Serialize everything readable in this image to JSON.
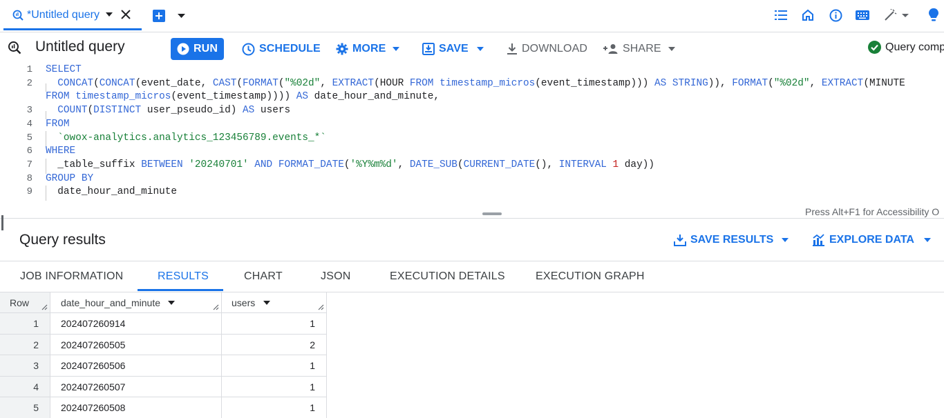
{
  "tabbar": {
    "tab_title": "*Untitled query",
    "icons": [
      "query-icon",
      "caret-down-icon",
      "close-icon",
      "add-tab-icon",
      "tab-menu-icon",
      "list-icon",
      "home-icon",
      "info-icon",
      "keyboard-icon",
      "magic-wand-icon",
      "lightbulb-icon"
    ]
  },
  "toolbar": {
    "title": "Untitled query",
    "run": "RUN",
    "schedule": "SCHEDULE",
    "more": "MORE",
    "save": "SAVE",
    "download": "DOWNLOAD",
    "share": "SHARE",
    "status": "Query comp",
    "status_color": "#188038"
  },
  "editor": {
    "line_numbers": [
      "1",
      "2",
      "",
      "3",
      "4",
      "5",
      "6",
      "7",
      "8",
      "9"
    ],
    "lines": [
      [
        {
          "t": "SELECT",
          "c": "kw"
        }
      ],
      [
        {
          "t": "  "
        },
        {
          "t": "CONCAT",
          "c": "fn"
        },
        {
          "t": "("
        },
        {
          "t": "CONCAT",
          "c": "fn"
        },
        {
          "t": "(event_date, "
        },
        {
          "t": "CAST",
          "c": "fn"
        },
        {
          "t": "("
        },
        {
          "t": "FORMAT",
          "c": "fn"
        },
        {
          "t": "("
        },
        {
          "t": "\"%02d\"",
          "c": "str"
        },
        {
          "t": ", "
        },
        {
          "t": "EXTRACT",
          "c": "fn"
        },
        {
          "t": "(HOUR "
        },
        {
          "t": "FROM",
          "c": "kw"
        },
        {
          "t": " "
        },
        {
          "t": "timestamp_micros",
          "c": "fn"
        },
        {
          "t": "(event_timestamp))) "
        },
        {
          "t": "AS",
          "c": "kw"
        },
        {
          "t": " "
        },
        {
          "t": "STRING",
          "c": "kw"
        },
        {
          "t": ")), "
        },
        {
          "t": "FORMAT",
          "c": "fn"
        },
        {
          "t": "("
        },
        {
          "t": "\"%02d\"",
          "c": "str"
        },
        {
          "t": ", "
        },
        {
          "t": "EXTRACT",
          "c": "fn"
        },
        {
          "t": "(MINUTE"
        }
      ],
      [
        {
          "t": "FROM",
          "c": "kw"
        },
        {
          "t": " "
        },
        {
          "t": "timestamp_micros",
          "c": "fn"
        },
        {
          "t": "(event_timestamp)))) "
        },
        {
          "t": "AS",
          "c": "kw"
        },
        {
          "t": " date_hour_and_minute,"
        }
      ],
      [
        {
          "t": "  "
        },
        {
          "t": "COUNT",
          "c": "fn"
        },
        {
          "t": "("
        },
        {
          "t": "DISTINCT",
          "c": "kw"
        },
        {
          "t": " user_pseudo_id) "
        },
        {
          "t": "AS",
          "c": "kw"
        },
        {
          "t": " users"
        }
      ],
      [
        {
          "t": "FROM",
          "c": "kw"
        }
      ],
      [
        {
          "t": "  "
        },
        {
          "t": "`owox-analytics.analytics_123456789.events_*`",
          "c": "bt"
        }
      ],
      [
        {
          "t": "WHERE",
          "c": "kw"
        }
      ],
      [
        {
          "t": "  _table_suffix "
        },
        {
          "t": "BETWEEN",
          "c": "kw"
        },
        {
          "t": " "
        },
        {
          "t": "'20240701'",
          "c": "str"
        },
        {
          "t": " "
        },
        {
          "t": "AND",
          "c": "kw"
        },
        {
          "t": " "
        },
        {
          "t": "FORMAT_DATE",
          "c": "fn"
        },
        {
          "t": "("
        },
        {
          "t": "'%Y%m%d'",
          "c": "str"
        },
        {
          "t": ", "
        },
        {
          "t": "DATE_SUB",
          "c": "fn"
        },
        {
          "t": "("
        },
        {
          "t": "CURRENT_DATE",
          "c": "fn"
        },
        {
          "t": "(), "
        },
        {
          "t": "INTERVAL",
          "c": "kw"
        },
        {
          "t": " "
        },
        {
          "t": "1",
          "c": "num"
        },
        {
          "t": " day))"
        }
      ],
      [
        {
          "t": "GROUP BY",
          "c": "kw"
        }
      ],
      [
        {
          "t": "  date_hour_and_minute"
        }
      ]
    ],
    "accessibility_hint": "Press Alt+F1 for Accessibility O"
  },
  "results": {
    "title": "Query results",
    "save_results": "SAVE RESULTS",
    "explore_data": "EXPLORE DATA",
    "tabs": [
      "JOB INFORMATION",
      "RESULTS",
      "CHART",
      "JSON",
      "EXECUTION DETAILS",
      "EXECUTION GRAPH"
    ],
    "active_tab": "RESULTS",
    "columns": [
      "Row",
      "date_hour_and_minute",
      "users"
    ],
    "rows": [
      [
        "1",
        "202407260914",
        "1"
      ],
      [
        "2",
        "202407260505",
        "2"
      ],
      [
        "3",
        "202407260506",
        "1"
      ],
      [
        "4",
        "202407260507",
        "1"
      ],
      [
        "5",
        "202407260508",
        "1"
      ]
    ]
  },
  "colors": {
    "accent": "#1a73e8",
    "success": "#188038",
    "keyword": "#3367d6",
    "string": "#188038",
    "number": "#c5221f"
  }
}
